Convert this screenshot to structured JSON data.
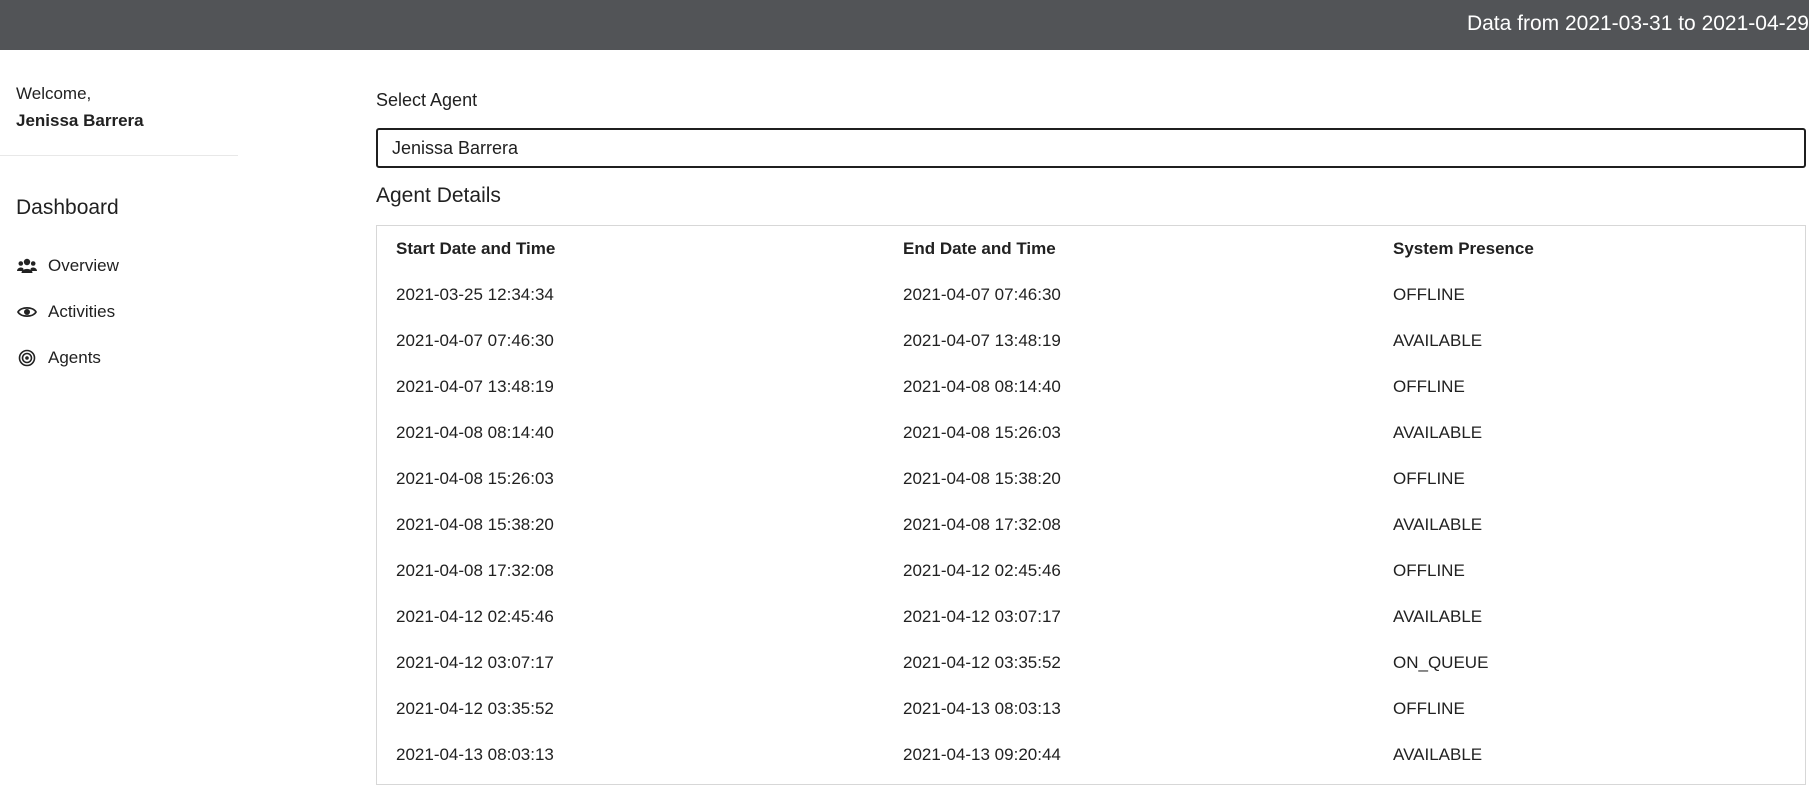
{
  "header": {
    "date_range": "Data from 2021-03-31 to 2021-04-29"
  },
  "sidebar": {
    "welcome_label": "Welcome,",
    "user_name": "Jenissa Barrera",
    "section_title": "Dashboard",
    "items": [
      {
        "label": "Overview",
        "icon": "users-icon"
      },
      {
        "label": "Activities",
        "icon": "eye-icon"
      },
      {
        "label": "Agents",
        "icon": "target-icon"
      }
    ]
  },
  "main": {
    "select_label": "Select Agent",
    "selected_agent": "Jenissa Barrera",
    "details_title": "Agent Details",
    "table": {
      "columns": [
        "Start Date and Time",
        "End Date and Time",
        "System Presence"
      ],
      "rows": [
        [
          "2021-03-25 12:34:34",
          "2021-04-07 07:46:30",
          "OFFLINE"
        ],
        [
          "2021-04-07 07:46:30",
          "2021-04-07 13:48:19",
          "AVAILABLE"
        ],
        [
          "2021-04-07 13:48:19",
          "2021-04-08 08:14:40",
          "OFFLINE"
        ],
        [
          "2021-04-08 08:14:40",
          "2021-04-08 15:26:03",
          "AVAILABLE"
        ],
        [
          "2021-04-08 15:26:03",
          "2021-04-08 15:38:20",
          "OFFLINE"
        ],
        [
          "2021-04-08 15:38:20",
          "2021-04-08 17:32:08",
          "AVAILABLE"
        ],
        [
          "2021-04-08 17:32:08",
          "2021-04-12 02:45:46",
          "OFFLINE"
        ],
        [
          "2021-04-12 02:45:46",
          "2021-04-12 03:07:17",
          "AVAILABLE"
        ],
        [
          "2021-04-12 03:07:17",
          "2021-04-12 03:35:52",
          "ON_QUEUE"
        ],
        [
          "2021-04-12 03:35:52",
          "2021-04-13 08:03:13",
          "OFFLINE"
        ],
        [
          "2021-04-13 08:03:13",
          "2021-04-13 09:20:44",
          "AVAILABLE"
        ]
      ]
    }
  },
  "colors": {
    "topbar": "#525457",
    "text": "#212121"
  }
}
